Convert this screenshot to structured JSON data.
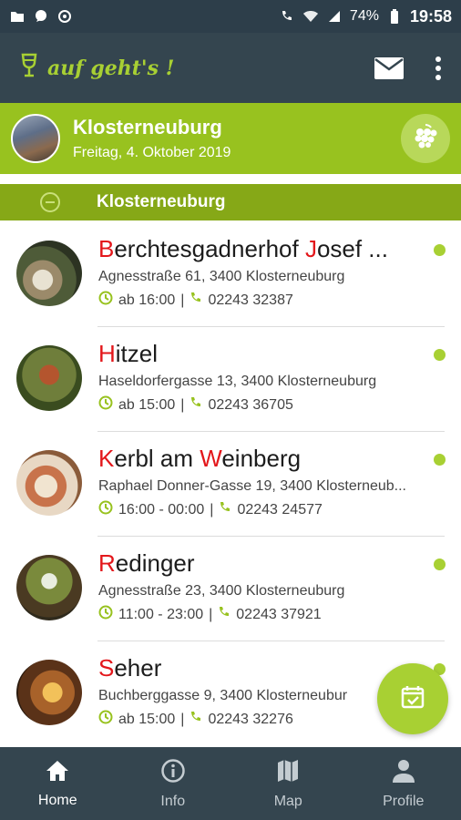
{
  "status_bar": {
    "battery": "74%",
    "time": "19:58"
  },
  "app": {
    "title": "auf geht's !"
  },
  "location": {
    "title": "Klosterneuburg",
    "date": "Freitag, 4. Oktober 2019"
  },
  "section": {
    "title": "Klosterneuburg"
  },
  "colors": {
    "accent": "#a8d033",
    "header_green": "#98c21f",
    "section_green": "#86a817",
    "dark": "#34454f",
    "initial_red": "#e3171b"
  },
  "venues": [
    {
      "name_initial": "B",
      "name_rest": "erchtesgadnerhof ",
      "name_initial2": "J",
      "name_rest2": "osef ...",
      "address": "Agnesstraße 61, 3400 Klosterneuburg",
      "hours": "ab 16:00",
      "phone": "02243 32387"
    },
    {
      "name_initial": "H",
      "name_rest": "itzel",
      "name_initial2": "",
      "name_rest2": "",
      "address": "Haseldorfergasse 13, 3400 Klosterneuburg",
      "hours": "ab 15:00",
      "phone": "02243 36705"
    },
    {
      "name_initial": "K",
      "name_rest": "erbl am ",
      "name_initial2": "W",
      "name_rest2": "einberg",
      "address": "Raphael Donner-Gasse 19, 3400 Klosterneub...",
      "hours": "16:00 - 00:00",
      "phone": "02243 24577"
    },
    {
      "name_initial": "R",
      "name_rest": "edinger",
      "name_initial2": "",
      "name_rest2": "",
      "address": "Agnesstraße 23, 3400 Klosterneuburg",
      "hours": "11:00 - 23:00",
      "phone": "02243 37921"
    },
    {
      "name_initial": "S",
      "name_rest": "eher",
      "name_initial2": "",
      "name_rest2": "",
      "address": "Buchberggasse 9, 3400 Klosterneubur",
      "hours": "ab 15:00",
      "phone": "02243 32276"
    }
  ],
  "bottom_nav": [
    {
      "label": "Home",
      "icon": "home-icon",
      "active": true
    },
    {
      "label": "Info",
      "icon": "info-icon",
      "active": false
    },
    {
      "label": "Map",
      "icon": "map-icon",
      "active": false
    },
    {
      "label": "Profile",
      "icon": "profile-icon",
      "active": false
    }
  ]
}
